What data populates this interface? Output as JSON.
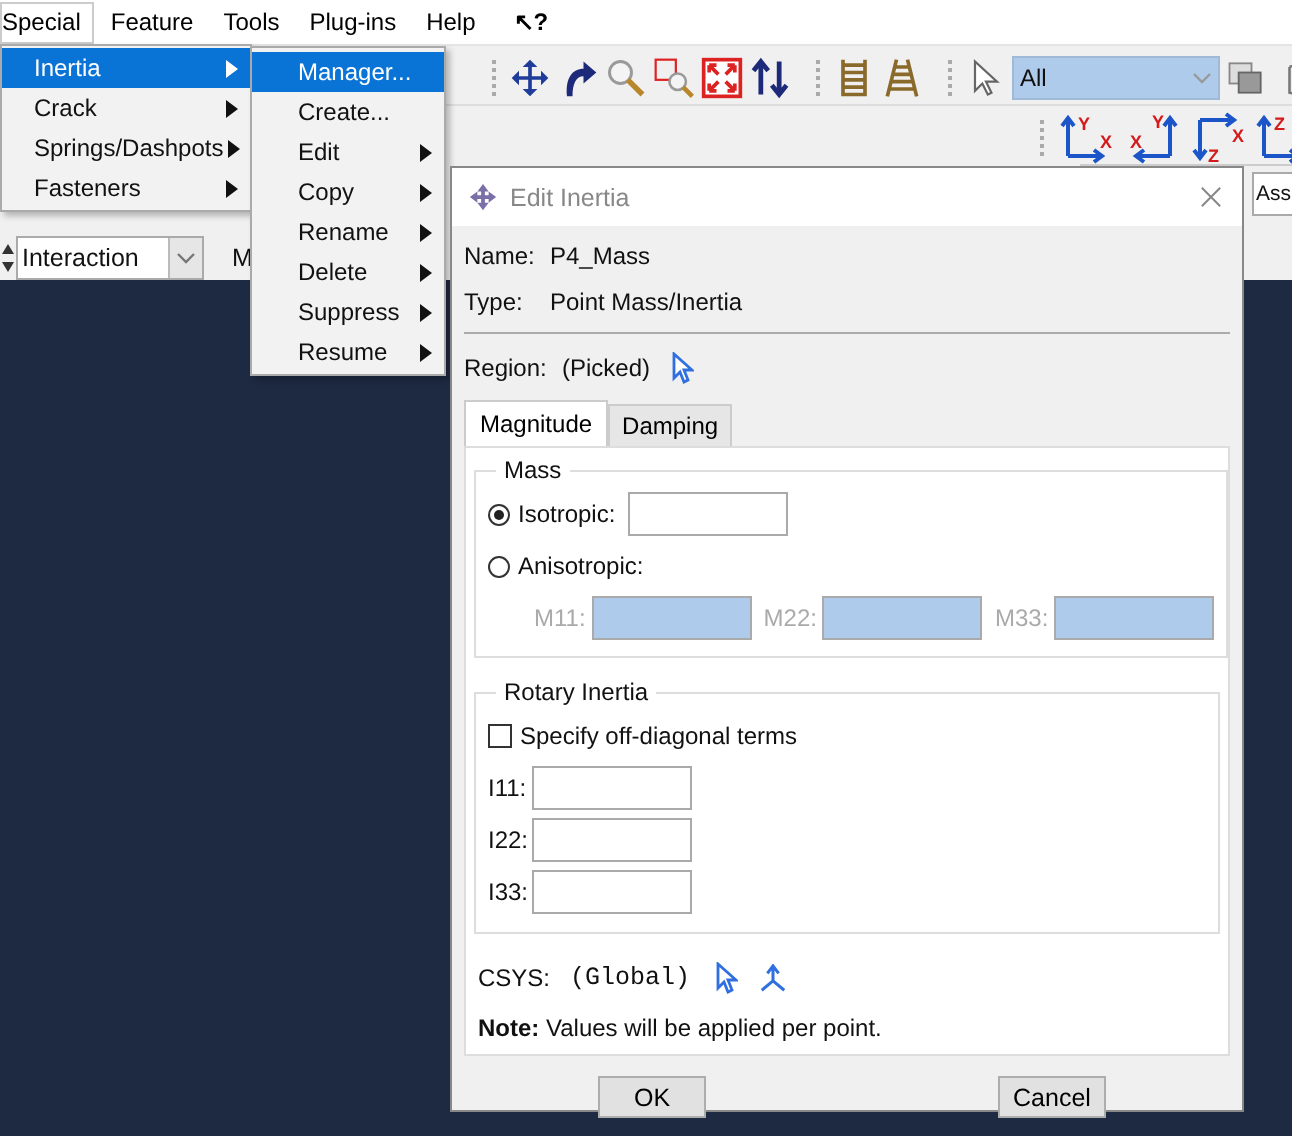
{
  "menubar": {
    "items": [
      {
        "label": "Special",
        "selected": true
      },
      {
        "label": "Feature",
        "selected": false
      },
      {
        "label": "Tools",
        "selected": false
      },
      {
        "label": "Plug-ins",
        "selected": false
      },
      {
        "label": "Help",
        "selected": false
      }
    ],
    "help_pointer": "↖?"
  },
  "menus": [
    {
      "items": [
        {
          "label": "Inertia",
          "selected": true,
          "submenu": true
        },
        {
          "label": "Crack",
          "selected": false,
          "submenu": true
        },
        {
          "label": "Springs/Dashpots",
          "selected": false,
          "submenu": true
        },
        {
          "label": "Fasteners",
          "selected": false,
          "submenu": true
        }
      ]
    },
    {
      "items": [
        {
          "label": "Manager...",
          "selected": true,
          "submenu": false
        },
        {
          "label": "Create...",
          "selected": false,
          "submenu": false
        },
        {
          "label": "Edit",
          "selected": false,
          "submenu": true
        },
        {
          "label": "Copy",
          "selected": false,
          "submenu": true
        },
        {
          "label": "Rename",
          "selected": false,
          "submenu": true
        },
        {
          "label": "Delete",
          "selected": false,
          "submenu": true
        },
        {
          "label": "Suppress",
          "selected": false,
          "submenu": true
        },
        {
          "label": "Resume",
          "selected": false,
          "submenu": true
        }
      ]
    }
  ],
  "toolbar": {
    "selection_filter": "All"
  },
  "view_buttons": [
    {
      "axes": [
        "Y",
        "X"
      ]
    },
    {
      "axes": [
        "X",
        "Y"
      ]
    },
    {
      "axes": [
        "Z",
        "X"
      ]
    },
    {
      "axes": [
        "Z"
      ]
    }
  ],
  "assembly_field": "Ass",
  "module_bar": {
    "module": "Interaction",
    "next_label": "M"
  },
  "dialog": {
    "title": "Edit Inertia",
    "name_label": "Name:",
    "name": "P4_Mass",
    "type_label": "Type:",
    "type": "Point Mass/Inertia",
    "region_label": "Region:",
    "region": "(Picked)",
    "tabs": [
      {
        "label": "Magnitude",
        "selected": true
      },
      {
        "label": "Damping",
        "selected": false
      }
    ],
    "mass": {
      "title": "Mass",
      "options": [
        {
          "label": "Isotropic:",
          "selected": true
        },
        {
          "label": "Anisotropic:",
          "selected": false
        }
      ],
      "components": [
        {
          "label": "M11:",
          "disabled": true
        },
        {
          "label": "M22:",
          "disabled": true
        },
        {
          "label": "M33:",
          "disabled": true
        }
      ]
    },
    "rotary": {
      "title": "Rotary Inertia",
      "off_diagonal": {
        "label": "Specify off-diagonal terms",
        "checked": false
      },
      "fields": [
        {
          "label": "I11:"
        },
        {
          "label": "I22:"
        },
        {
          "label": "I33:"
        }
      ]
    },
    "csys_label": "CSYS:",
    "csys": "(Global)",
    "note": "**Note:**  Values will be applied per point.",
    "buttons": [
      "OK",
      "Cancel"
    ]
  }
}
